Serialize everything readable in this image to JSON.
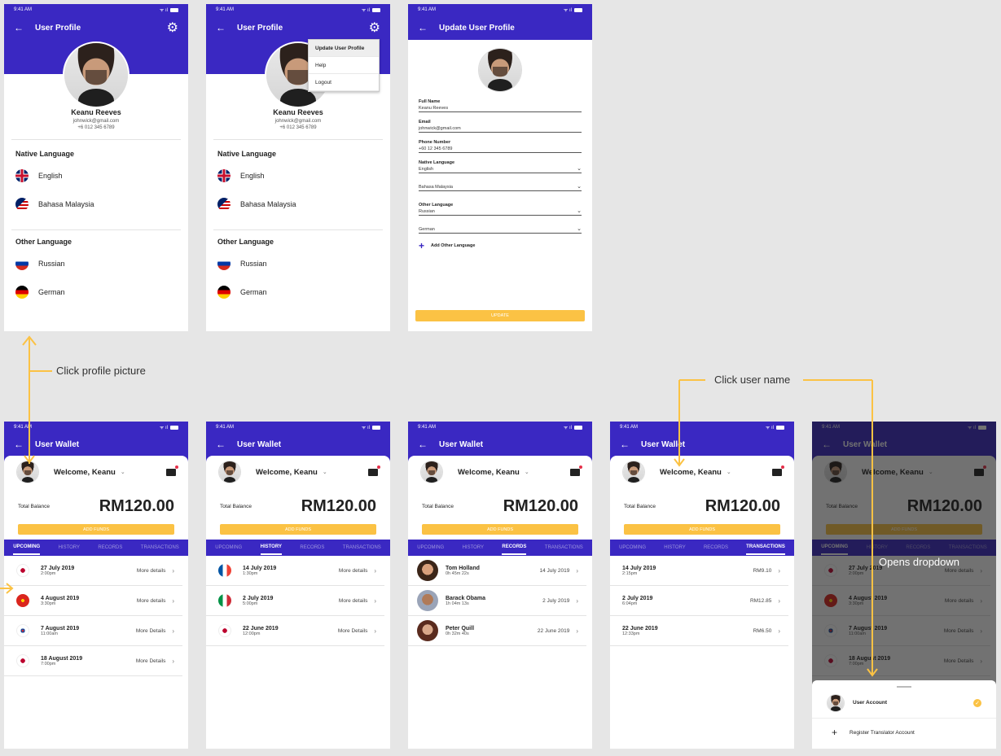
{
  "status": {
    "time": "9:41 AM",
    "time_clipped": "9:41",
    "time_cut": "AM"
  },
  "profile": {
    "title": "User Profile",
    "name": "Keanu Reeves",
    "email": "johnwick@gmail.com",
    "phone": "+6 012 345 6789",
    "native_title": "Native Language",
    "native": [
      "English",
      "Bahasa Malaysia"
    ],
    "other_title": "Other Language",
    "other": [
      "Russian",
      "German"
    ]
  },
  "menu": {
    "items": [
      "Update User Profile",
      "Help",
      "Logout"
    ]
  },
  "update": {
    "title": "Update User Profile",
    "fields": [
      {
        "label": "Full Name",
        "value": "Keanu Reeves"
      },
      {
        "label": "Email",
        "value": "johnwick@gmail.com"
      },
      {
        "label": "Phone Number",
        "value": "+60 12 345 6789"
      }
    ],
    "native_label": "Native Language",
    "native": [
      "English",
      "Bahasa Malaysia"
    ],
    "other_label": "Other Language",
    "other": [
      "Russian",
      "German"
    ],
    "add_other": "Add Other Language",
    "button": "UPDATE"
  },
  "wallet": {
    "title": "User Wallet",
    "welcome": "Welcome, Keanu",
    "balance_label": "Total Balance",
    "balance": "RM120.00",
    "add_funds": "ADD FUNDS",
    "tabs": [
      "UPCOMING",
      "HISTORY",
      "RECORDS",
      "TRANSACTIONS"
    ]
  },
  "upcoming": [
    {
      "date": "27 July 2019",
      "time": "2:00pm",
      "link": "More details",
      "flag": "japan"
    },
    {
      "date": "4 August 2019",
      "time": "3:30pm",
      "link": "More details",
      "flag": "vietnam"
    },
    {
      "date": "7 August 2019",
      "time": "11:00am",
      "link": "More Details",
      "flag": "korea"
    },
    {
      "date": "18 August 2019",
      "time": "7:00pm",
      "link": "More Details",
      "flag": "japan"
    }
  ],
  "history": [
    {
      "date": "14 July 2019",
      "time": "1:30pm",
      "link": "More details",
      "flag": "france"
    },
    {
      "date": "2 July 2019",
      "time": "5:00pm",
      "link": "More details",
      "flag": "italy"
    },
    {
      "date": "22 June 2019",
      "time": "12:00pm",
      "link": "More Details",
      "flag": "japan"
    }
  ],
  "records": [
    {
      "name": "Tom Holland",
      "duration": "0h 45m 22s",
      "date": "14 July 2019"
    },
    {
      "name": "Barack Obama",
      "duration": "1h 04m 13s",
      "date": "2 July 2019"
    },
    {
      "name": "Peter Quill",
      "duration": "0h 32m 40s",
      "date": "22 June 2019"
    }
  ],
  "transactions": [
    {
      "date": "14 July 2019",
      "time": "2:15pm",
      "amount": "RM9.10"
    },
    {
      "date": "2 July 2019",
      "time": "6:04pm",
      "amount": "RM12.85"
    },
    {
      "date": "22 June 2019",
      "time": "12:33pm",
      "amount": "RM6.50"
    }
  ],
  "annotations": {
    "click_profile": "Click profile picture",
    "click_user": "Click user name",
    "opens_dropdown": "Opens dropdown"
  },
  "sheet": {
    "account": "User Account",
    "register": "Register Translator Account"
  },
  "colors": {
    "primary": "#3a28c2",
    "accent": "#fbc244",
    "background": "#e6e6e6"
  }
}
